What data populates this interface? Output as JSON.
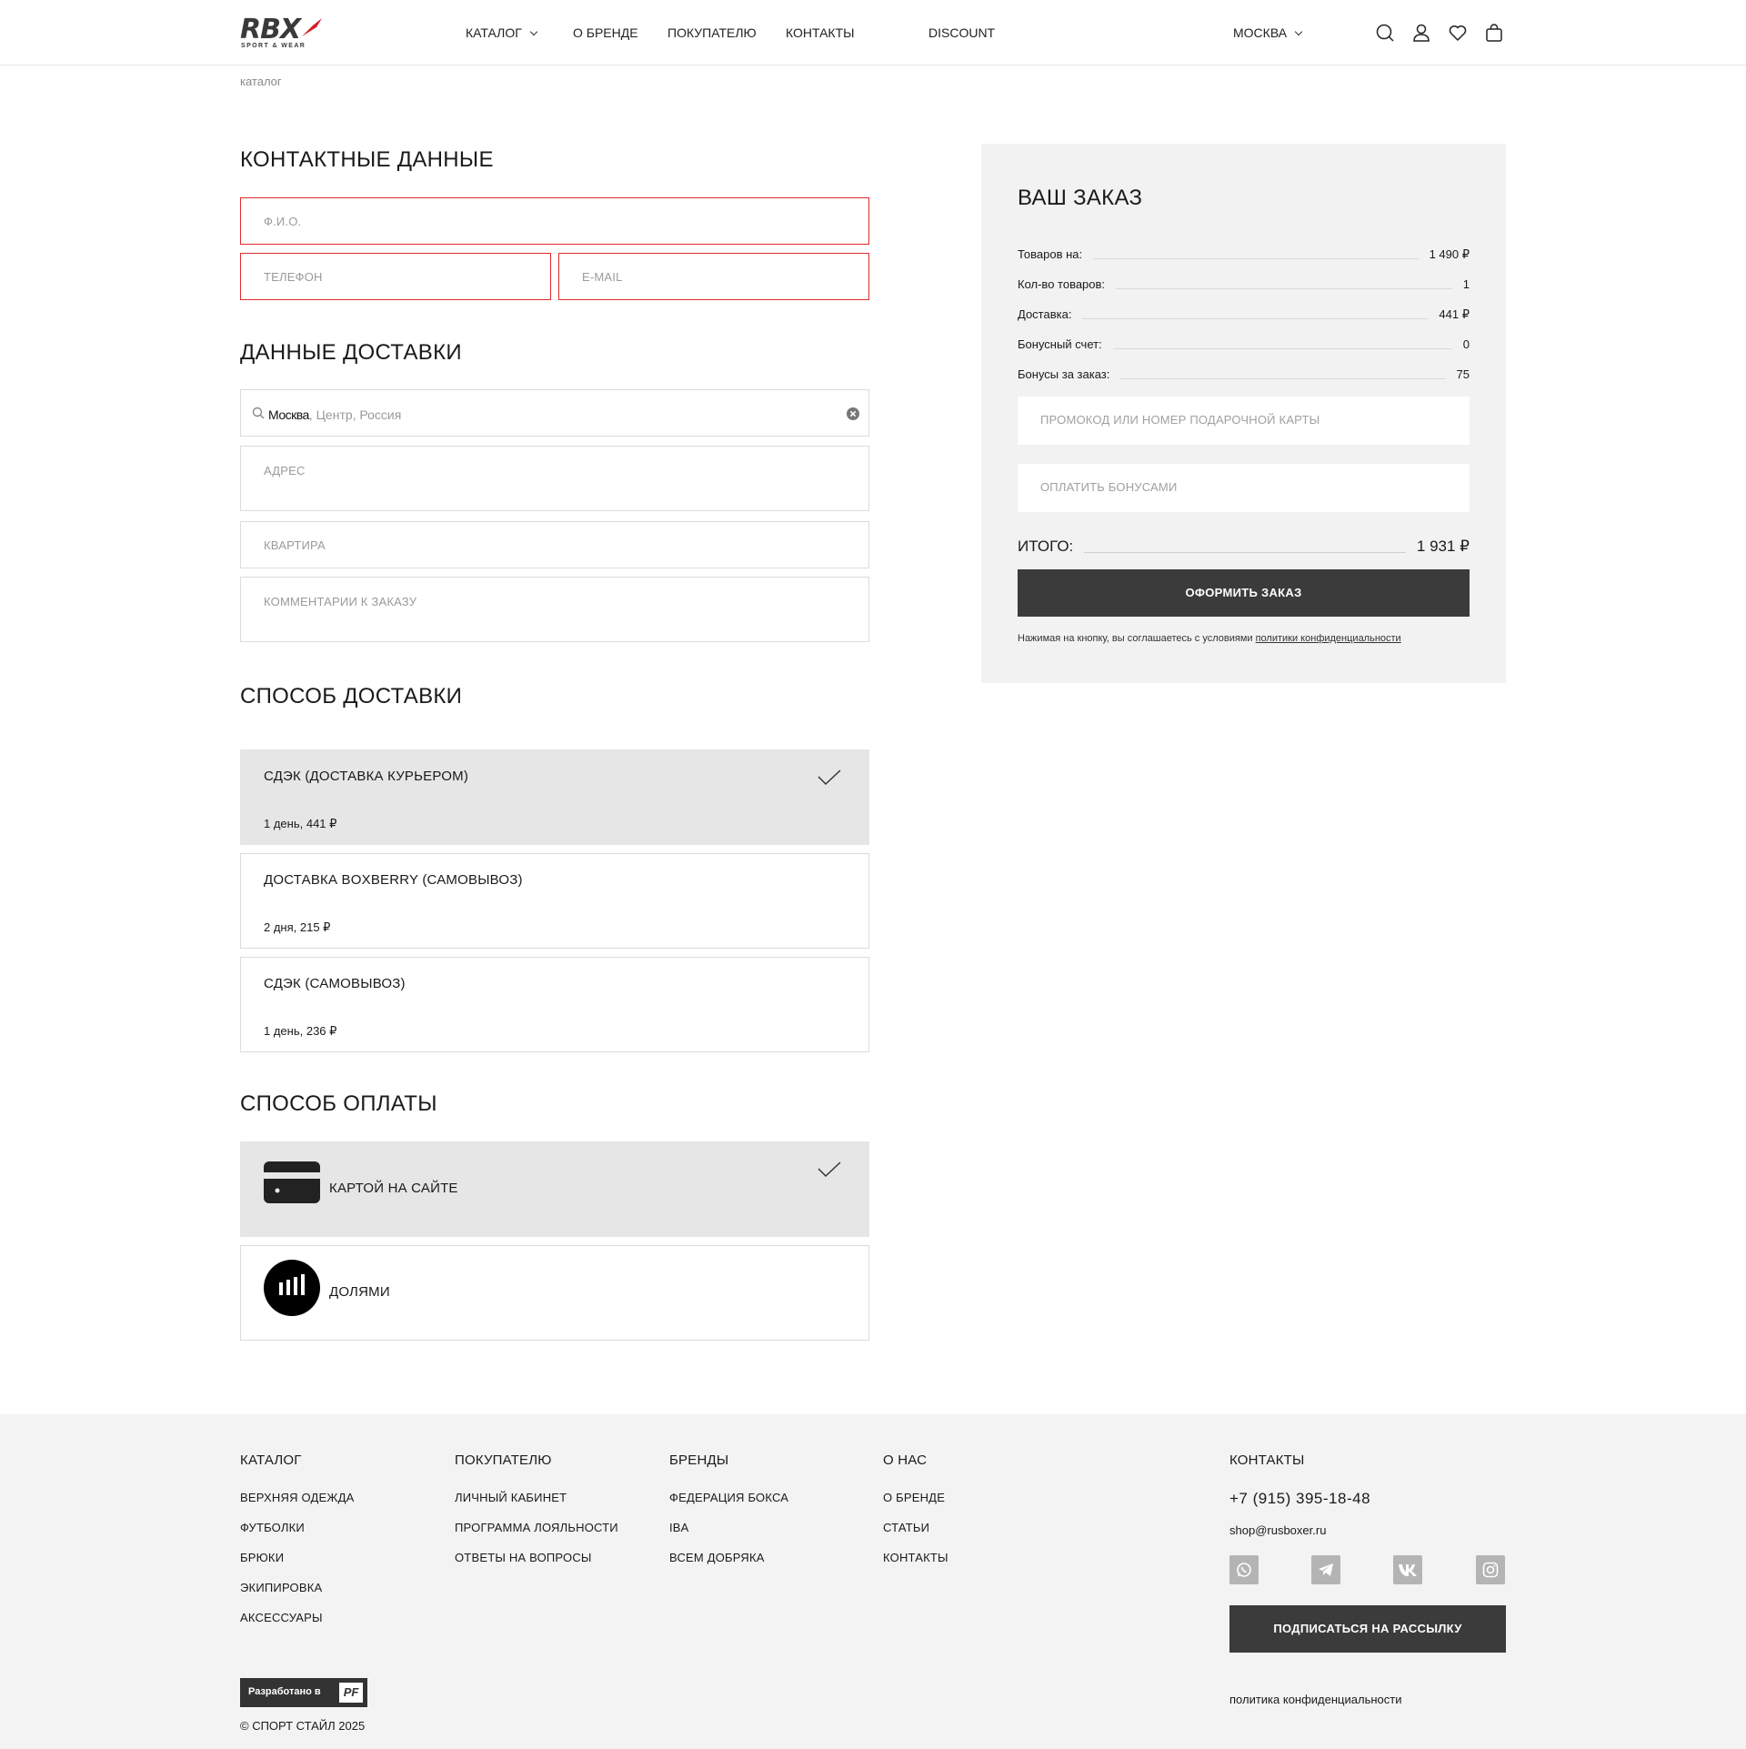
{
  "header": {
    "logo_text": "RBX",
    "logo_sub": "SPORT & WEAR",
    "nav": [
      "КАТАЛОГ",
      "О БРЕНДЕ",
      "ПОКУПАТЕЛЮ",
      "КОНТАКТЫ",
      "DISCOUNT"
    ],
    "city": "МОСКВА",
    "icons": [
      "search-icon",
      "user-icon",
      "heart-icon",
      "cart-icon"
    ]
  },
  "breadcrumb": "каталог",
  "contacts": {
    "title": "КОНТАКТНЫЕ ДАННЫЕ",
    "name_placeholder": "Ф.И.О.",
    "phone_placeholder": "ТЕЛЕФОН",
    "email_placeholder": "E-MAIL"
  },
  "delivery_data": {
    "title": "ДАННЫЕ ДОСТАВКИ",
    "city_value": "Москва",
    "city_hint": ", Центр, Россия",
    "address_placeholder": "АДРЕС",
    "apartment_placeholder": "КВАРТИРА",
    "comment_placeholder": "КОММЕНТАРИИ К ЗАКАЗУ"
  },
  "delivery_method": {
    "title": "СПОСОБ ДОСТАВКИ",
    "options": [
      {
        "label": "СДЭК (ДОСТАВКА КУРЬЕРОМ)",
        "detail": "1 день, 441 ₽",
        "selected": true
      },
      {
        "label": "ДОСТАВКА BOXBERRY (САМОВЫВОЗ)",
        "detail": "2 дня, 215 ₽",
        "selected": false
      },
      {
        "label": "СДЭК (САМОВЫВОЗ)",
        "detail": "1 день, 236 ₽",
        "selected": false
      }
    ]
  },
  "payment": {
    "title": "СПОСОБ ОПЛАТЫ",
    "options": [
      {
        "label": "КАРТОЙ НА САЙТЕ",
        "icon": "card-icon",
        "selected": true
      },
      {
        "label": "ДОЛЯМИ",
        "icon": "dolyami-icon",
        "selected": false
      }
    ]
  },
  "order": {
    "title": "ВАШ ЗАКАЗ",
    "rows": [
      {
        "label": "Товаров на:",
        "value": "1 490 ₽"
      },
      {
        "label": "Кол-во товаров:",
        "value": "1"
      },
      {
        "label": "Доставка:",
        "value": "441 ₽"
      },
      {
        "label": "Бонусный счет:",
        "value": "0"
      },
      {
        "label": "Бонусы за заказ:",
        "value": "75"
      }
    ],
    "promo_placeholder": "ПРОМОКОД ИЛИ НОМЕР ПОДАРОЧНОЙ КАРТЫ",
    "bonus_placeholder": "ОПЛАТИТЬ БОНУСАМИ",
    "total_label": "ИТОГО:",
    "total_value": "1 931 ₽",
    "submit_label": "ОФОРМИТЬ ЗАКАЗ",
    "agree_text": "Нажимая на кнопку, вы соглашаетесь с условиями ",
    "agree_link": "политики конфиденциальности"
  },
  "footer": {
    "columns": [
      {
        "title": "КАТАЛОГ",
        "links": [
          "ВЕРХНЯЯ ОДЕЖДА",
          "ФУТБОЛКИ",
          "БРЮКИ",
          "ЭКИПИРОВКА",
          "АКСЕССУАРЫ"
        ]
      },
      {
        "title": "ПОКУПАТЕЛЮ",
        "links": [
          "ЛИЧНЫЙ КАБИНЕТ",
          "ПРОГРАММА ЛОЯЛЬНОСТИ",
          "ОТВЕТЫ НА ВОПРОСЫ"
        ]
      },
      {
        "title": "БРЕНДЫ",
        "links": [
          "ФЕДЕРАЦИЯ БОКСА",
          "IBA",
          "ВСЕМ ДОБРЯКА"
        ]
      },
      {
        "title": "О НАС",
        "links": [
          "О БРЕНДЕ",
          "СТАТЬИ",
          "КОНТАКТЫ"
        ]
      }
    ],
    "contacts_title": "КОНТАКТЫ",
    "phone": "+7 (915) 395-18-48",
    "email": "shop@rusboxer.ru",
    "socials": [
      "whatsapp-icon",
      "telegram-icon",
      "vk-icon",
      "instagram-icon"
    ],
    "subscribe_label": "ПОДПИСАТЬСЯ НА РАССЫЛКУ",
    "developed_by": "Разработано в",
    "developer_logo": "PF",
    "copyright": "© СПОРТ СТАЙЛ 2025",
    "policy": "политика конфиденциальности"
  },
  "colors": {
    "error_border": "#e02a2a",
    "dark_button": "#3b3b3b",
    "summary_bg": "#f2f2f2",
    "selected_option_bg": "#e6e6e6",
    "logo_accent": "#d3202a"
  }
}
